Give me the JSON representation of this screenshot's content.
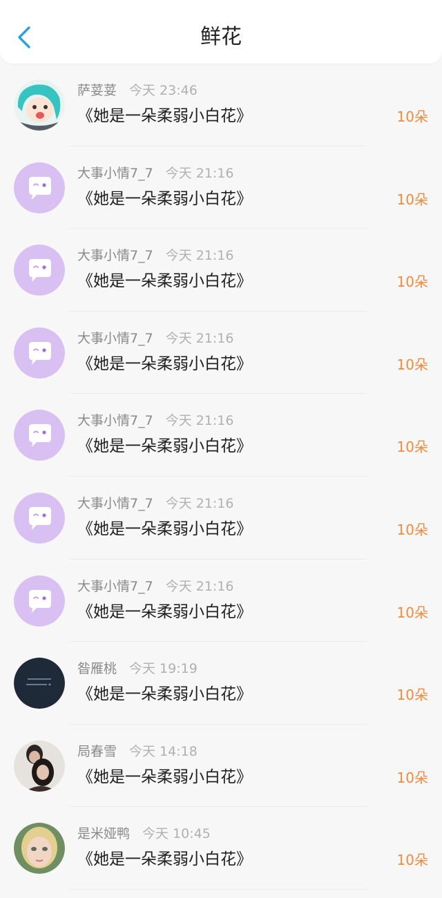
{
  "header": {
    "title": "鲜花",
    "back_icon": "chevron-left-icon",
    "accent_color": "#2aa0e0"
  },
  "list": {
    "amount_color": "#f08a3c",
    "items": [
      {
        "name": "萨荽荽",
        "time": "今天 23:46",
        "book": "《她是一朵柔弱小白花》",
        "amount": "10朵",
        "avatar": "anime-avatar"
      },
      {
        "name": "大事小情7_7",
        "time": "今天 21:16",
        "book": "《她是一朵柔弱小白花》",
        "amount": "10朵",
        "avatar": "default-chat-avatar"
      },
      {
        "name": "大事小情7_7",
        "time": "今天 21:16",
        "book": "《她是一朵柔弱小白花》",
        "amount": "10朵",
        "avatar": "default-chat-avatar"
      },
      {
        "name": "大事小情7_7",
        "time": "今天 21:16",
        "book": "《她是一朵柔弱小白花》",
        "amount": "10朵",
        "avatar": "default-chat-avatar"
      },
      {
        "name": "大事小情7_7",
        "time": "今天 21:16",
        "book": "《她是一朵柔弱小白花》",
        "amount": "10朵",
        "avatar": "default-chat-avatar"
      },
      {
        "name": "大事小情7_7",
        "time": "今天 21:16",
        "book": "《她是一朵柔弱小白花》",
        "amount": "10朵",
        "avatar": "default-chat-avatar"
      },
      {
        "name": "大事小情7_7",
        "time": "今天 21:16",
        "book": "《她是一朵柔弱小白花》",
        "amount": "10朵",
        "avatar": "default-chat-avatar"
      },
      {
        "name": "昝雁桃",
        "time": "今天 19:19",
        "book": "《她是一朵柔弱小白花》",
        "amount": "10朵",
        "avatar": "dark-text-avatar"
      },
      {
        "name": "局春雪",
        "time": "今天 14:18",
        "book": "《她是一朵柔弱小白花》",
        "amount": "10朵",
        "avatar": "photo-couple-avatar"
      },
      {
        "name": "是米娅鸭",
        "time": "今天 10:45",
        "book": "《她是一朵柔弱小白花》",
        "amount": "10朵",
        "avatar": "photo-face-avatar"
      }
    ]
  }
}
